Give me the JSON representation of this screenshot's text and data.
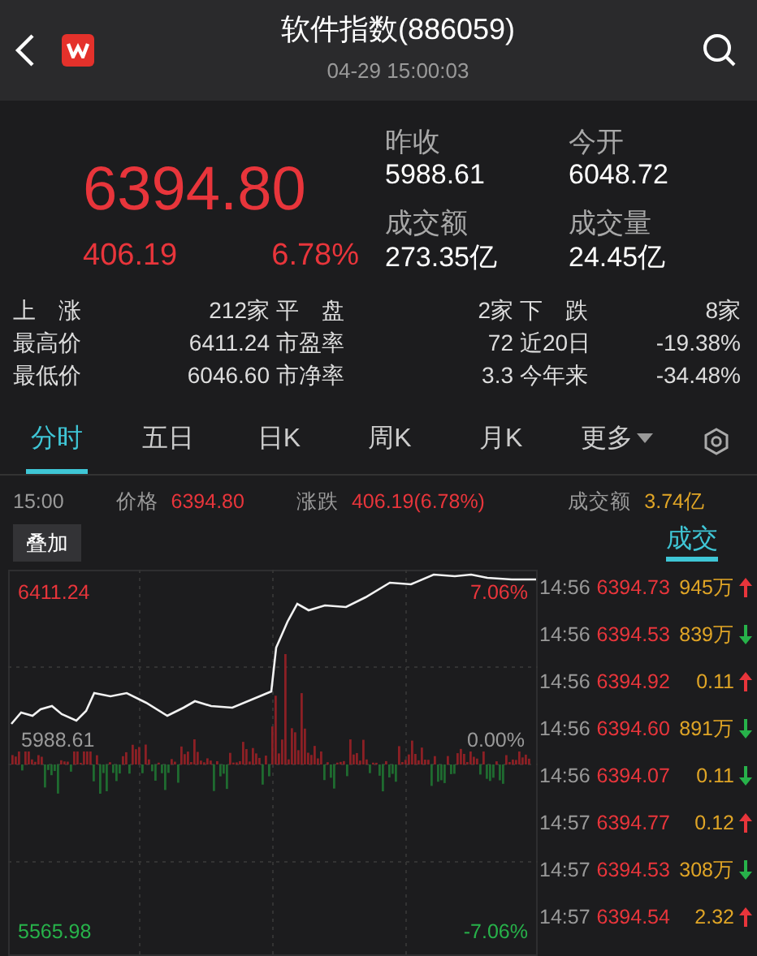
{
  "header": {
    "title": "软件指数(886059)",
    "datetime": "04-29 15:00:03"
  },
  "quote": {
    "price": "6394.80",
    "change": "406.19",
    "change_pct": "6.78%"
  },
  "stats": [
    {
      "label": "昨收",
      "value": "5988.61"
    },
    {
      "label": "今开",
      "value": "6048.72"
    },
    {
      "label": "成交额",
      "value": "273.35亿"
    },
    {
      "label": "成交量",
      "value": "24.45亿"
    }
  ],
  "breadth": [
    [
      {
        "label": "上　涨",
        "value": "212家"
      },
      {
        "label": "平　盘",
        "value": "2家"
      },
      {
        "label": "下　跌",
        "value": "8家"
      }
    ],
    [
      {
        "label": "最高价",
        "value": "6411.24"
      },
      {
        "label": "市盈率",
        "value": "72"
      },
      {
        "label": "近20日",
        "value": "-19.38%"
      }
    ],
    [
      {
        "label": "最低价",
        "value": "6046.60"
      },
      {
        "label": "市净率",
        "value": "3.3"
      },
      {
        "label": "今年来",
        "value": "-34.48%"
      }
    ]
  ],
  "tabs": [
    {
      "label": "分时",
      "selected": true
    },
    {
      "label": "五日",
      "selected": false
    },
    {
      "label": "日K",
      "selected": false
    },
    {
      "label": "周K",
      "selected": false
    },
    {
      "label": "月K",
      "selected": false
    },
    {
      "label": "更多",
      "selected": false,
      "kind": "dropdown"
    }
  ],
  "info_bar": {
    "time": "15:00",
    "price_label": "价格",
    "price": "6394.80",
    "change_label": "涨跌",
    "change": "406.19(6.78%)",
    "amount_label": "成交额",
    "amount": "3.74亿"
  },
  "overlay_button": "叠加",
  "trade_tab": {
    "label": "成交",
    "selected": true
  },
  "chart_labels": {
    "high": "6411.24",
    "high_pct": "7.06%",
    "base": "5988.61",
    "base_pct": "0.00%",
    "low": "5565.98",
    "low_pct": "-7.06%"
  },
  "trades": [
    {
      "time": "14:56",
      "price": "6394.73",
      "volume": "945万",
      "up": true
    },
    {
      "time": "14:56",
      "price": "6394.53",
      "volume": "839万",
      "up": false
    },
    {
      "time": "14:56",
      "price": "6394.92",
      "volume": "0.11",
      "up": true
    },
    {
      "time": "14:56",
      "price": "6394.60",
      "volume": "891万",
      "up": false
    },
    {
      "time": "14:56",
      "price": "6394.07",
      "volume": "0.11",
      "up": false
    },
    {
      "time": "14:57",
      "price": "6394.77",
      "volume": "0.12",
      "up": true
    },
    {
      "time": "14:57",
      "price": "6394.53",
      "volume": "308万",
      "up": false
    },
    {
      "time": "14:57",
      "price": "6394.54",
      "volume": "2.32",
      "up": true
    }
  ]
}
